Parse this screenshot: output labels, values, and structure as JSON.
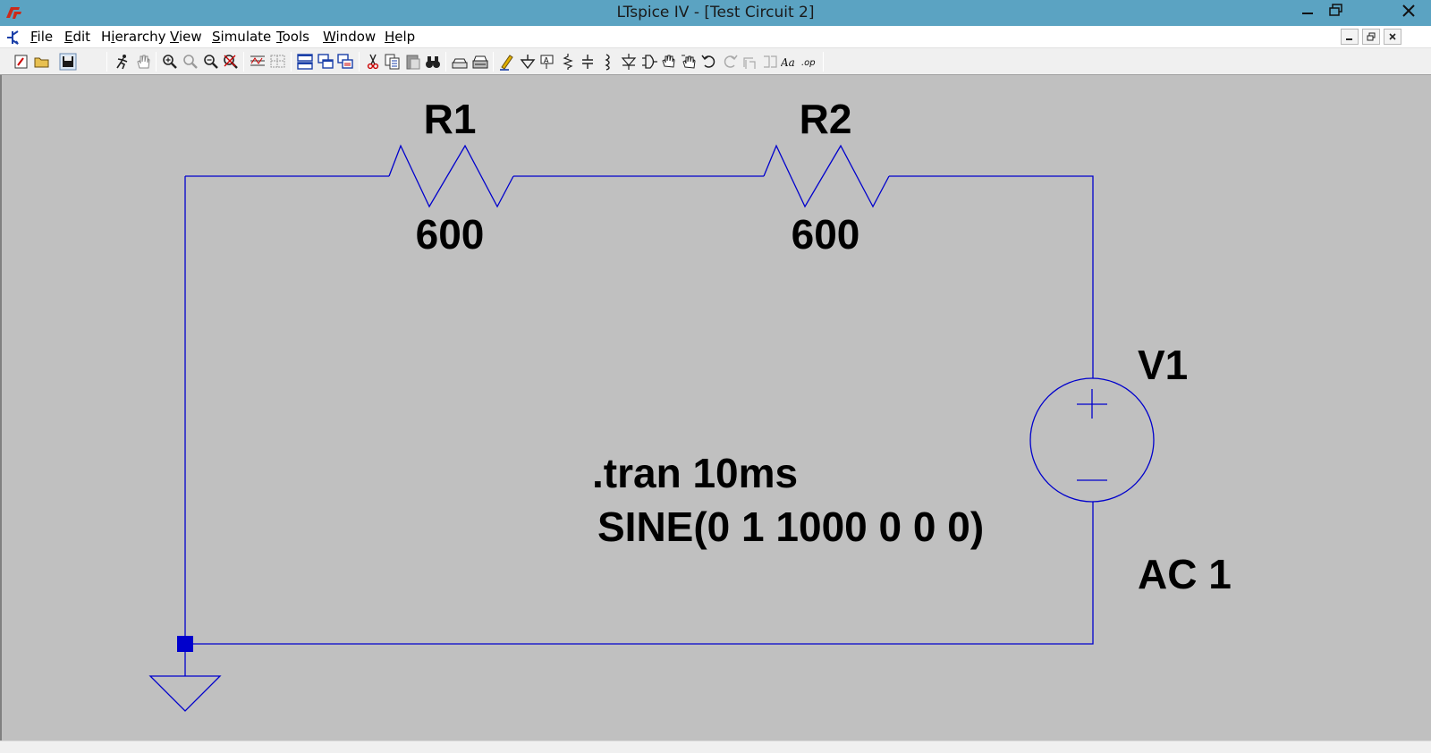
{
  "window": {
    "title": "LTspice IV - [Test Circuit 2]"
  },
  "menu": {
    "items": [
      {
        "label": "File",
        "hotkey_index": 0
      },
      {
        "label": "Edit",
        "hotkey_index": 0
      },
      {
        "label": "Hierarchy",
        "hotkey_index": 1
      },
      {
        "label": "View",
        "hotkey_index": 0
      },
      {
        "label": "Simulate",
        "hotkey_index": 0
      },
      {
        "label": "Tools",
        "hotkey_index": 0
      },
      {
        "label": "Window",
        "hotkey_index": 0
      },
      {
        "label": "Help",
        "hotkey_index": 0
      }
    ]
  },
  "toolbar": {
    "icons": [
      "new-schematic-icon",
      "open-icon",
      "save-icon",
      "run-icon",
      "pan-icon",
      "zoom-in-icon",
      "zoom-area-icon",
      "zoom-out-icon",
      "zoom-fit-icon",
      "autorange-icon",
      "grid-icon",
      "tile-horizontal-icon",
      "cascade-icon",
      "tile-vertical-icon",
      "cut-icon",
      "copy-icon",
      "paste-icon",
      "find-icon",
      "print-preview-icon",
      "print-icon",
      "draw-wire-icon",
      "ground-icon",
      "label-net-icon",
      "resistor-icon",
      "capacitor-icon",
      "inductor-icon",
      "diode-icon",
      "component-icon",
      "move-icon",
      "drag-icon",
      "undo-icon",
      "redo-icon",
      "rotate-icon",
      "mirror-icon",
      "text-icon",
      "spice-directive-icon"
    ],
    "text_icon_label": "Aa",
    "spice_icon_label": ".op"
  },
  "schematic": {
    "colors": {
      "wire": "#0000cc",
      "background": "#c0c0c0",
      "text": "#000000"
    },
    "components": {
      "r1": {
        "name": "R1",
        "value": "600"
      },
      "r2": {
        "name": "R2",
        "value": "600"
      },
      "v1": {
        "name": "V1",
        "value": "SINE(0 1 1000 0 0 0)",
        "ac": "AC 1"
      }
    },
    "directive": ".tran 10ms"
  }
}
